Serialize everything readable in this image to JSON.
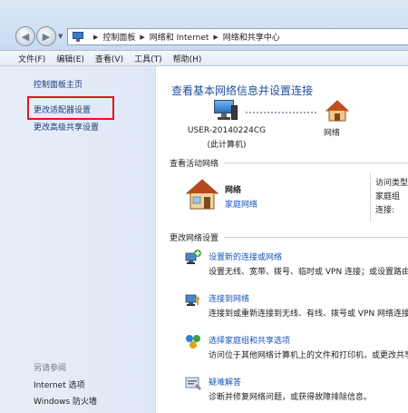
{
  "address_bar": {
    "breadcrumbs": [
      "控制面板",
      "网络和 Internet",
      "网络和共享中心"
    ]
  },
  "menu": {
    "items": [
      "文件(F)",
      "编辑(E)",
      "查看(V)",
      "工具(T)",
      "帮助(H)"
    ]
  },
  "left_pane": {
    "home": "控制面板主页",
    "links": [
      "更改适配器设置",
      "更改高级共享设置"
    ],
    "see_also_title": "另请参阅",
    "see_also": [
      "Internet 选项",
      "Windows 防火墙"
    ],
    "highlight_color": "#e0161b"
  },
  "main": {
    "title": "查看基本网络信息并设置连接",
    "map": {
      "computer_name": "USER-20140224CG",
      "computer_sub": "(此计算机)",
      "network_label": "网络"
    },
    "active_section_title": "查看活动网络",
    "active_network": {
      "name": "网络",
      "type": "家庭网络",
      "access_type_label": "访问类型",
      "homegroup_label": "家庭组",
      "connections_label": "连接:"
    },
    "change_section_title": "更改网络设置",
    "tasks": [
      {
        "icon": "new-connection-icon",
        "link": "设置新的连接或网络",
        "desc": "设置无线、宽带、拨号、临时或 VPN 连接；或设置路由器或访问点。"
      },
      {
        "icon": "connect-network-icon",
        "link": "连接到网络",
        "desc": "连接到或重新连接到无线、有线、拨号或 VPN 网络连接。"
      },
      {
        "icon": "homegroup-icon",
        "link": "选择家庭组和共享选项",
        "desc": "访问位于其他网络计算机上的文件和打印机，或更改共享设置。"
      },
      {
        "icon": "troubleshoot-icon",
        "link": "疑难解答",
        "desc": "诊断并修复网络问题，或获得故障排除信息。"
      }
    ],
    "link_color": "#1a56b8",
    "title_color": "#1e4f9c"
  }
}
